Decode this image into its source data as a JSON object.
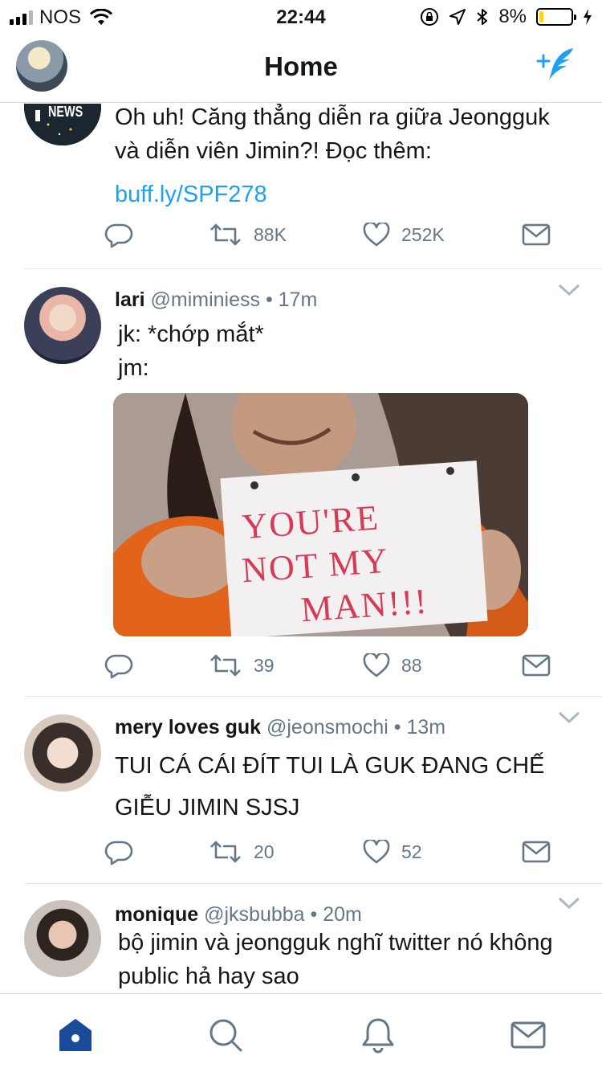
{
  "status_bar": {
    "carrier": "NOS",
    "time": "22:44",
    "battery_percent": "8%",
    "battery_level": 0.08,
    "icons": [
      "signal-icon",
      "wifi-icon",
      "orientation-lock-icon",
      "location-icon",
      "bluetooth-icon",
      "battery-icon",
      "charging-icon"
    ]
  },
  "header": {
    "title": "Home",
    "compose_icon": "compose-tweet-icon"
  },
  "tweets": [
    {
      "avatar": "enews-logo",
      "avatar_text": "NEWS",
      "text_line1": "Oh uh! Căng thẳng diễn ra giữa Jeongguk",
      "text_line2": "và diễn viên Jimin?! Đọc thêm:",
      "link": "buff.ly/SPF278",
      "retweets": "88K",
      "likes": "252K"
    },
    {
      "name": "lari",
      "handle": "@miminiess",
      "time": "• 17m",
      "text_line1": "jk: *chớp mắt*",
      "text_line2": "jm:",
      "media_text": [
        "YOU'RE",
        "NOT MY",
        "MAN!!!"
      ],
      "retweets": "39",
      "likes": "88"
    },
    {
      "name": "mery loves guk",
      "handle": "@jeonsmochi",
      "time": "• 13m",
      "text_line1": "TUI CÁ CÁI ĐÍT TUI LÀ GUK ĐANG CHẾ",
      "text_line2": "GIỄU JIMIN SJSJ",
      "retweets": "20",
      "likes": "52"
    },
    {
      "name": "monique",
      "handle": "@jksbubba",
      "time": "• 20m",
      "text_line1": "bộ jimin và jeongguk nghĩ twitter nó không",
      "text_line2": "public hả hay sao"
    }
  ],
  "tabbar": {
    "tabs": [
      "home-icon",
      "search-icon",
      "notifications-icon",
      "messages-icon"
    ],
    "active": "home-icon"
  },
  "colors": {
    "accent": "#1da1f2",
    "tab_active": "#1a4b9a",
    "muted": "#657786"
  }
}
